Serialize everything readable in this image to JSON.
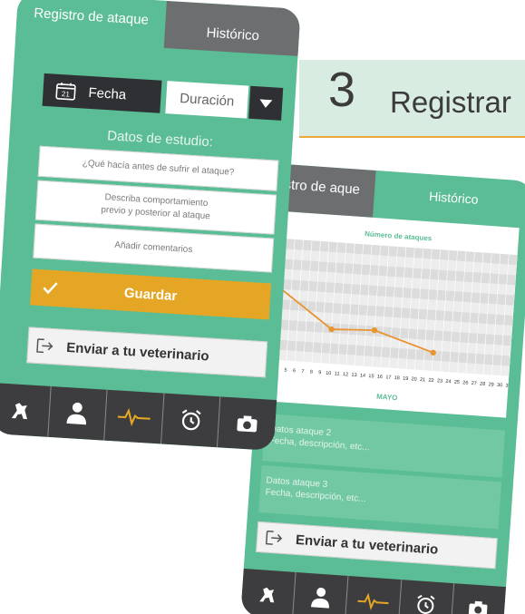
{
  "section": {
    "number": "3",
    "title": "Registrar"
  },
  "front_phone": {
    "tabs": {
      "register": "Registro de ataque",
      "history": "Histórico"
    },
    "date_label": "Fecha",
    "duration_label": "Duración",
    "study_label": "Datos de estudio:",
    "fields": {
      "before_attack": "¿Qué hacía antes de sufrir el ataque?",
      "behaviour": "Describa comportamiento previo y posterior al ataque",
      "comments": "Añadir comentarios"
    },
    "save_label": "Guardar",
    "send_label": "Enviar a tu veterinario"
  },
  "back_phone": {
    "tabs": {
      "register": "istro de aque",
      "history": "Histórico"
    },
    "chart_month": "MAYO",
    "records": [
      {
        "title": "Datos ataque 2",
        "detail": "Fecha, descripción, etc..."
      },
      {
        "title": "Datos ataque 3",
        "detail": "Fecha, descripción, etc..."
      }
    ],
    "send_label": "Enviar a tu veterinario"
  },
  "chart_data": {
    "type": "line",
    "title": "Número de ataques",
    "xlabel": "MAYO",
    "x": [
      3,
      10,
      15,
      22
    ],
    "values": [
      7.5,
      3.4,
      3.6,
      1.8
    ],
    "xlim": [
      3,
      31
    ],
    "ylim": [
      0,
      12
    ],
    "tick_labels": [
      "4",
      "5",
      "6",
      "7",
      "8",
      "9",
      "10",
      "11",
      "12",
      "13",
      "14",
      "15",
      "16",
      "17",
      "18",
      "19",
      "20",
      "21",
      "22",
      "23",
      "24",
      "25",
      "26",
      "27",
      "28",
      "29",
      "30",
      "31"
    ],
    "line_color": "#e89430",
    "grid": true
  },
  "colors": {
    "brand_green": "#5bbd95",
    "accent_orange": "#e4a624",
    "dark": "#3d3d3f"
  },
  "nav_icons": [
    "dog-icon",
    "vet-icon",
    "pulse-icon",
    "alarm-clock-icon",
    "camera-icon"
  ]
}
